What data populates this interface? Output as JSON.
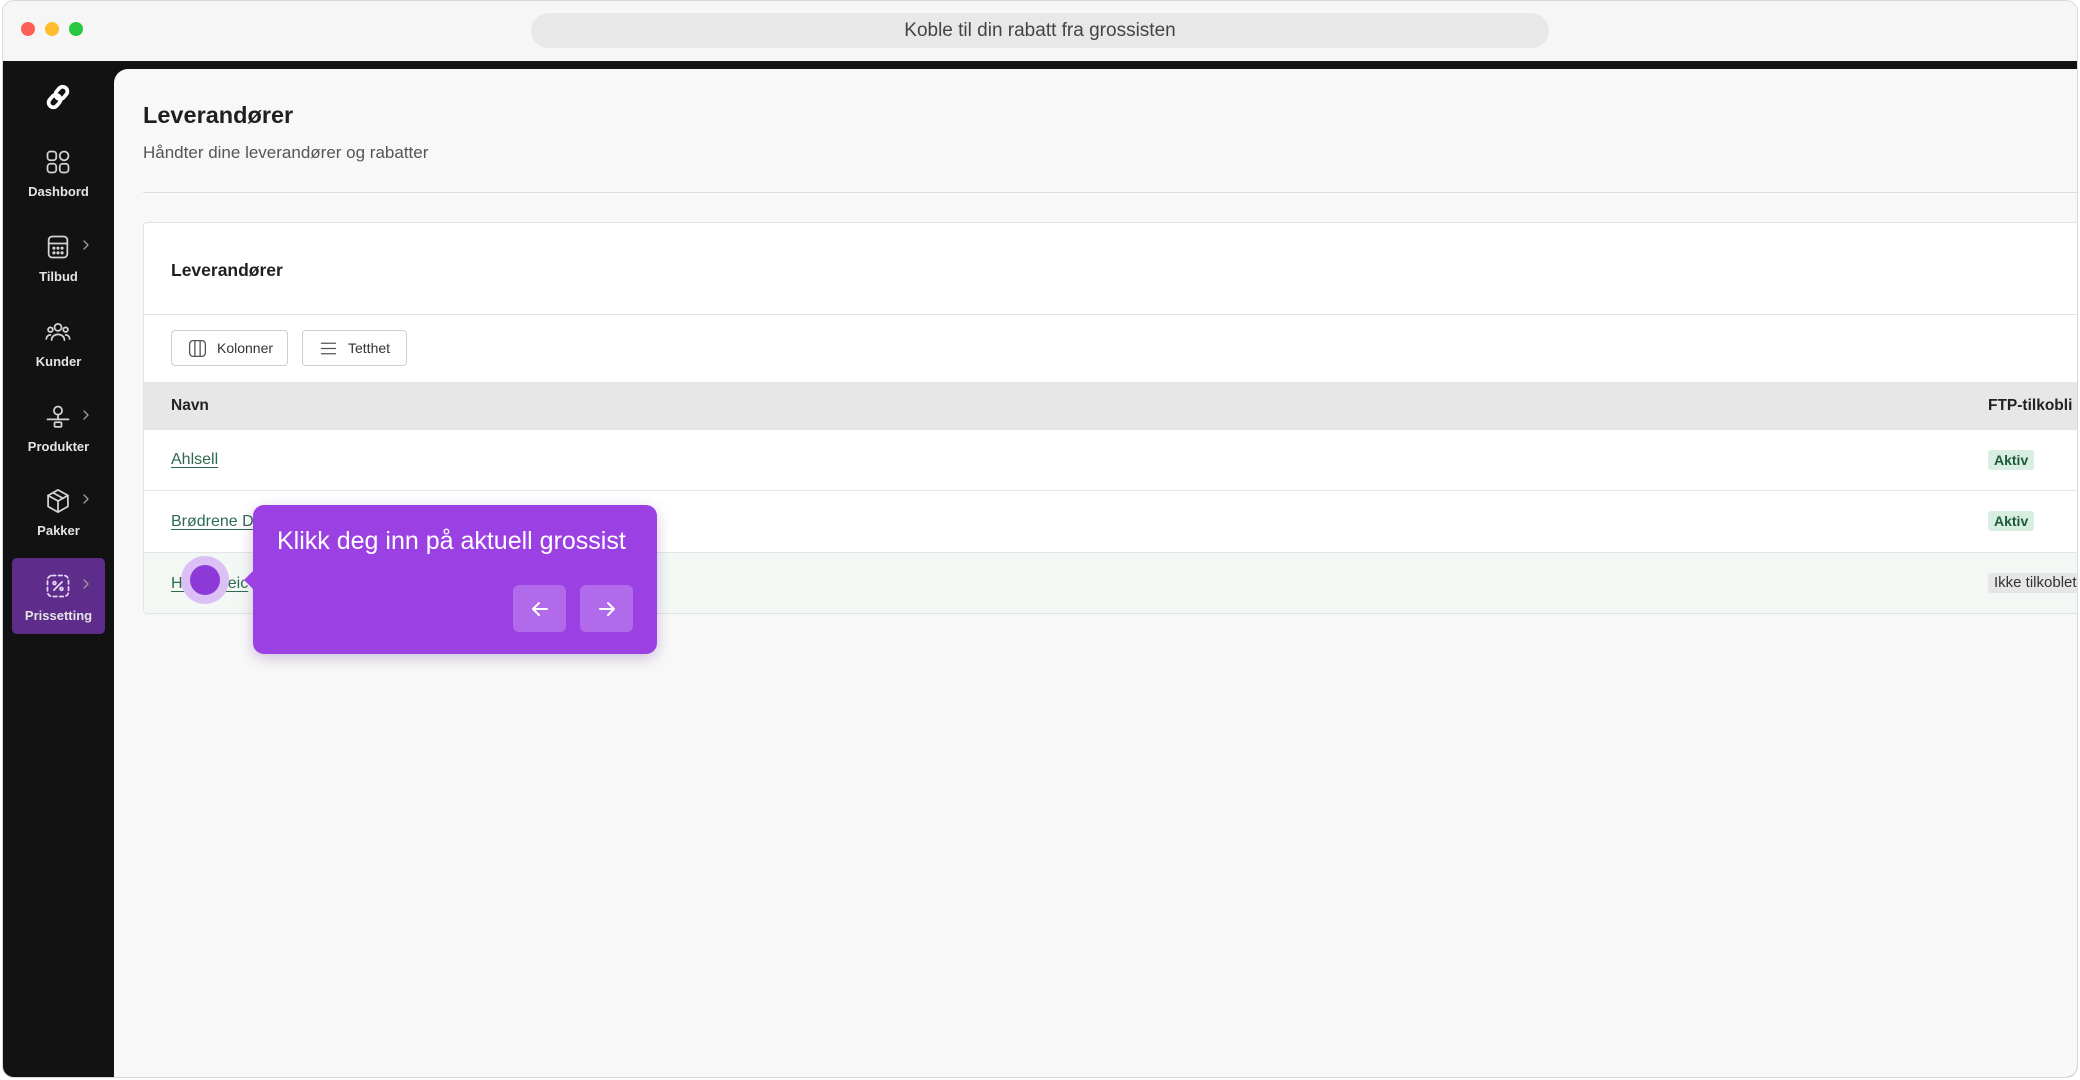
{
  "window": {
    "title": "Koble til din rabatt fra grossisten"
  },
  "sidebar": {
    "logo_icon": "app-logo-icon",
    "items": [
      {
        "label": "Dashbord",
        "icon": "dashboard-icon",
        "has_submenu": false,
        "active": false
      },
      {
        "label": "Tilbud",
        "icon": "calculator-icon",
        "has_submenu": true,
        "active": false
      },
      {
        "label": "Kunder",
        "icon": "users-icon",
        "has_submenu": false,
        "active": false
      },
      {
        "label": "Produkter",
        "icon": "product-icon",
        "has_submenu": true,
        "active": false
      },
      {
        "label": "Pakker",
        "icon": "package-icon",
        "has_submenu": true,
        "active": false
      },
      {
        "label": "Prissetting",
        "icon": "price-tag-icon",
        "has_submenu": true,
        "active": true
      }
    ]
  },
  "page": {
    "title": "Leverandører",
    "subtitle": "Håndter dine leverandører og rabatter"
  },
  "suppliers_card": {
    "title": "Leverandører",
    "toolbar": {
      "columns_label": "Kolonner",
      "columns_icon": "columns-icon",
      "density_label": "Tetthet",
      "density_icon": "density-icon"
    },
    "columns": [
      {
        "label": "Navn"
      },
      {
        "label": "FTP-tilkobli"
      }
    ],
    "rows": [
      {
        "name": "Ahlsell",
        "ftp_status": "Aktiv"
      },
      {
        "name": "Brødrene D",
        "ftp_status": "Aktiv"
      },
      {
        "name_parts": [
          "He",
          "reic"
        ],
        "ftp_status": "Ikke tilkoblet",
        "highlighted": true
      }
    ]
  },
  "tooltip": {
    "text": "Klikk deg inn på aktuell grossist",
    "back_icon": "arrow-left-icon",
    "next_icon": "arrow-right-icon"
  },
  "colors": {
    "accent": "#9b40e3",
    "sidebar_bg": "#121212",
    "sidebar_active": "#5e2d8c",
    "link": "#2d6a4f",
    "badge_active_bg": "#d7eee1",
    "badge_active_text": "#1f5a3d",
    "badge_inactive_bg": "#e6e6e6",
    "row_highlight": "#f3f8f5"
  }
}
